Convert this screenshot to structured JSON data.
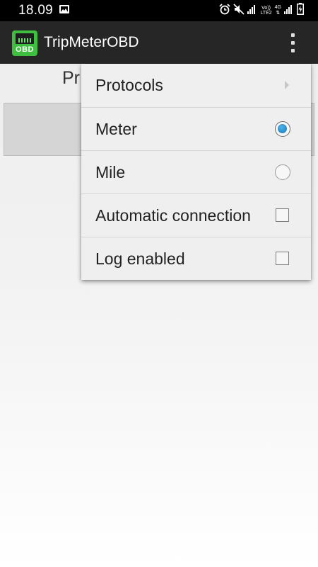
{
  "status_bar": {
    "time": "18.09",
    "volte_line1": "Vo))",
    "volte_line2": "LTE2",
    "net_label": "4G"
  },
  "app_bar": {
    "logo_text": "OBD",
    "title": "TripMeterOBD"
  },
  "background": {
    "label_fragment": "Pr"
  },
  "menu": {
    "items": [
      {
        "label": "Protocols",
        "control": "submenu-arrow"
      },
      {
        "label": "Meter",
        "control": "radio",
        "checked": true
      },
      {
        "label": "Mile",
        "control": "radio",
        "checked": false
      },
      {
        "label": "Automatic connection",
        "control": "checkbox",
        "checked": false
      },
      {
        "label": "Log enabled",
        "control": "checkbox",
        "checked": false
      }
    ]
  },
  "colors": {
    "app_bar": "#262626",
    "logo_green": "#3fbf3f",
    "radio_accent": "#1479b8",
    "menu_bg": "#efefef"
  }
}
